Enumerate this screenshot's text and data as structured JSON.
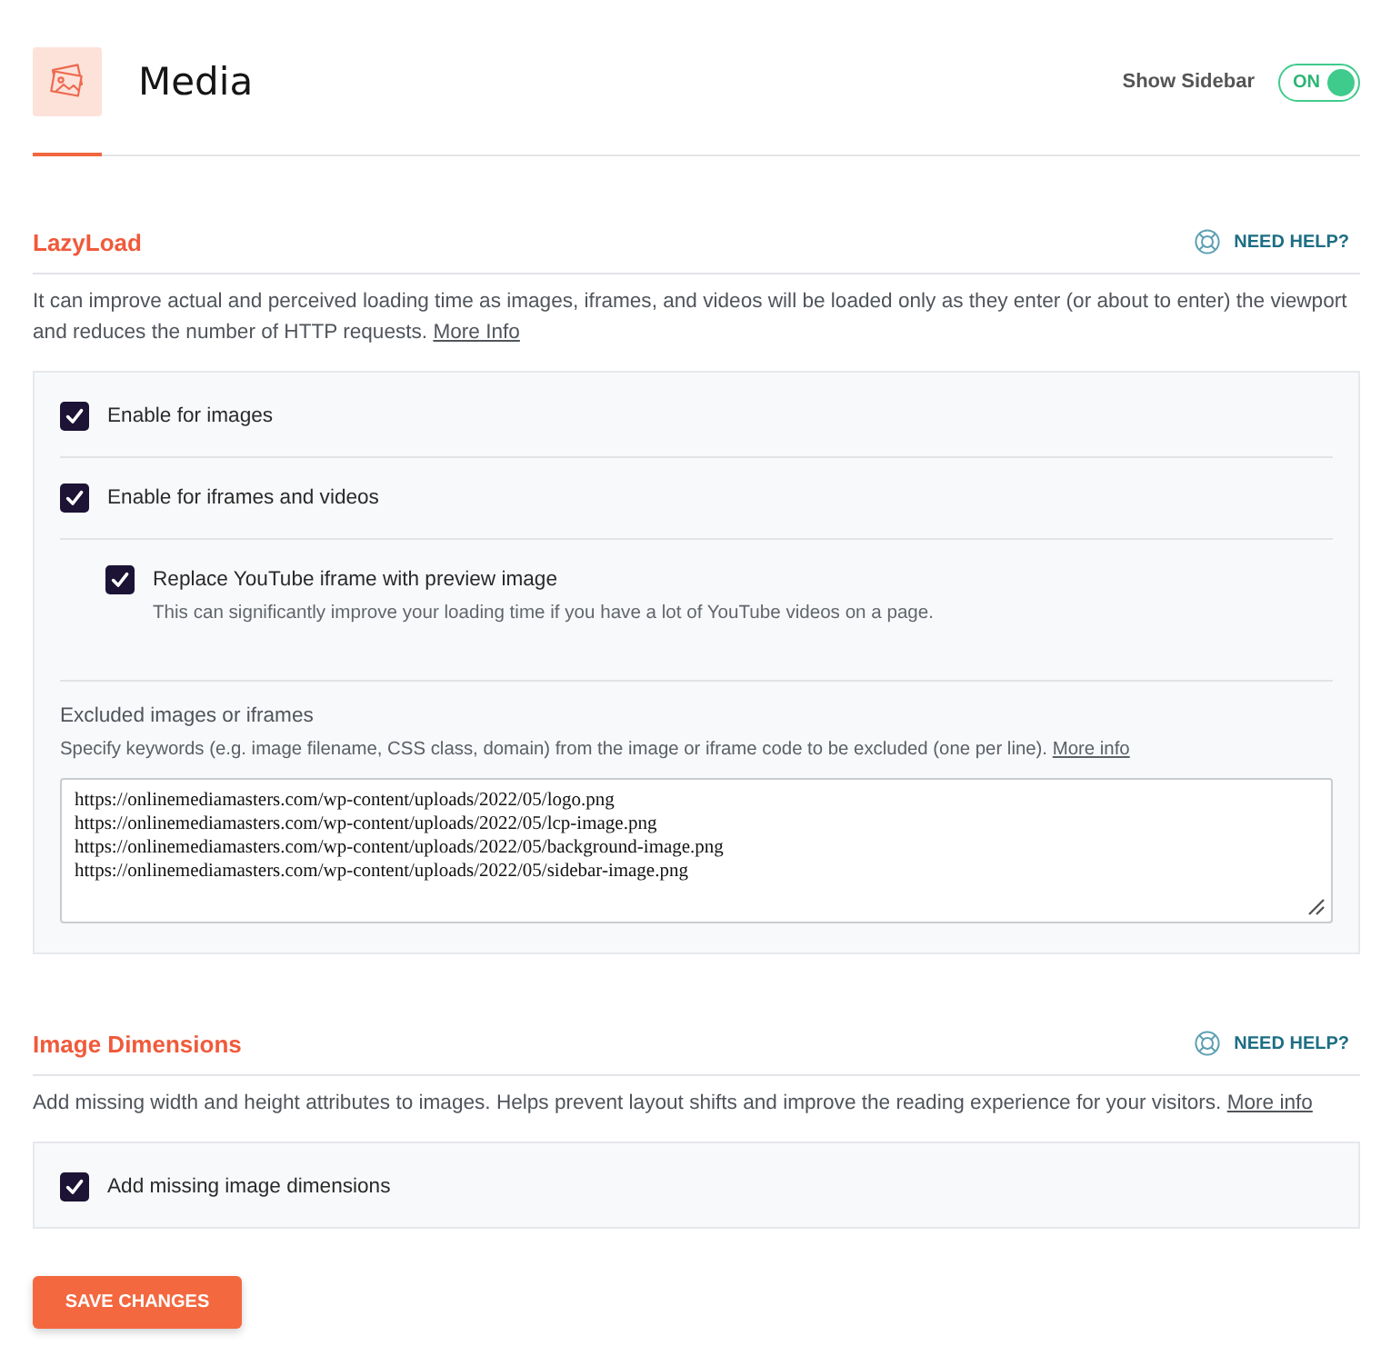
{
  "header": {
    "title": "Media",
    "sidebar_toggle": {
      "label": "Show Sidebar",
      "state_label": "ON",
      "on": true
    }
  },
  "sections": [
    {
      "title": "LazyLoad",
      "help": "NEED HELP?",
      "description": "It can improve actual and perceived loading time as images, iframes, and videos will be loaded only as they enter (or about to enter) the viewport and reduces the number of HTTP requests.",
      "description_link": "More Info",
      "options": [
        {
          "kind": "checkbox",
          "label": "Enable for images",
          "checked": true
        },
        {
          "kind": "checkbox",
          "label": "Enable for iframes and videos",
          "checked": true,
          "children": [
            {
              "kind": "checkbox",
              "label": "Replace YouTube iframe with preview image",
              "description": "This can significantly improve your loading time if you have a lot of YouTube videos on a page.",
              "checked": true
            }
          ]
        },
        {
          "kind": "textarea",
          "label": "Excluded images or iframes",
          "description": "Specify keywords (e.g. image filename, CSS class, domain) from the image or iframe code to be excluded (one per line).",
          "link": "More info",
          "lines": [
            "https://onlinemediamasters.com/wp-content/uploads/2022/05/logo.png",
            "https://onlinemediamasters.com/wp-content/uploads/2022/05/lcp-image.png",
            "https://onlinemediamasters.com/wp-content/uploads/2022/05/background-image.png",
            "https://onlinemediamasters.com/wp-content/uploads/2022/05/sidebar-image.png"
          ]
        }
      ]
    },
    {
      "title": "Image Dimensions",
      "help": "NEED HELP?",
      "description": "Add missing width and height attributes to images. Helps prevent layout shifts and improve the reading experience for your visitors.",
      "description_link": "More info",
      "options": [
        {
          "kind": "checkbox",
          "label": "Add missing image dimensions",
          "checked": true
        }
      ]
    }
  ],
  "save_button": "SAVE CHANGES"
}
